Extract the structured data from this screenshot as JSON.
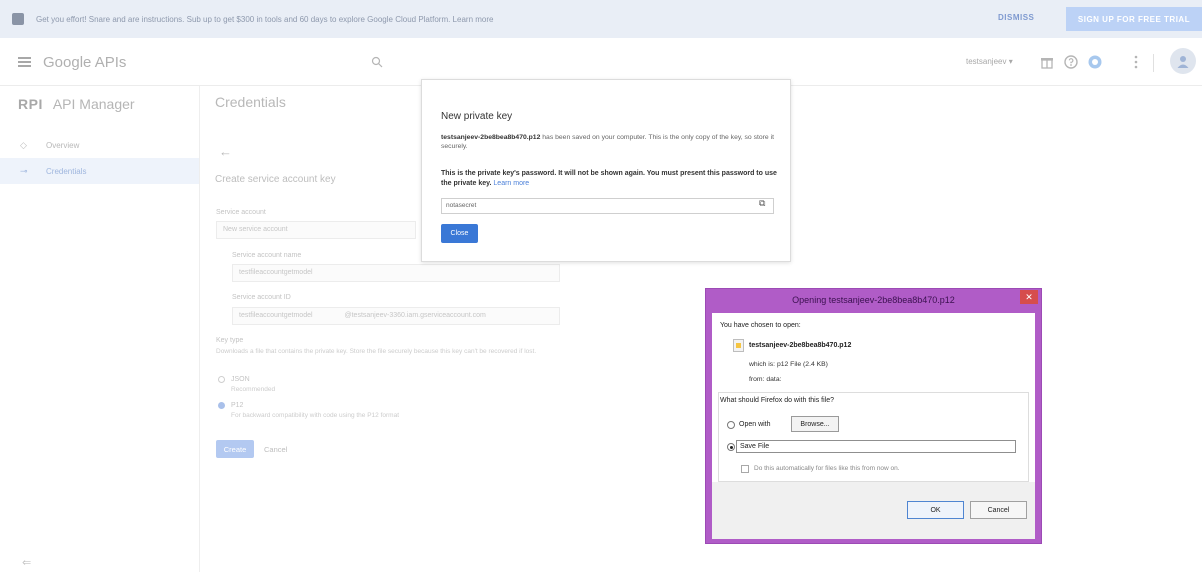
{
  "banner": {
    "text": "Get you effort! Snare and are instructions. Sub up to get $300 in tools and 60 days to explore Google Cloud Platform. Learn more",
    "dismiss_label": "DISMISS",
    "signup_label": "SIGN UP FOR FREE TRIAL"
  },
  "header": {
    "logo_text": "Google APIs",
    "project_label": "testsanjeev",
    "icons": [
      "menu-icon",
      "search-icon",
      "gift-icon",
      "help-icon",
      "notifications-icon",
      "more-icon",
      "account-icon"
    ]
  },
  "sidenav": {
    "badge": "RPI",
    "title": "API Manager",
    "items": [
      {
        "label": "Overview",
        "icon": "diamond-icon"
      },
      {
        "label": "Credentials",
        "icon": "key-icon"
      }
    ],
    "collapse_glyph": "⇐"
  },
  "main": {
    "page_title": "Credentials",
    "form_heading": "Create service account key",
    "service_account_label": "Service account",
    "service_account_value": "New service account",
    "name_label": "Service account name",
    "name_value": "testfileaccountgetmodel",
    "id_label": "Service account ID",
    "id_value": "testfileaccountgetmodel",
    "id_suffix": "@testsanjeev-3360.iam.gserviceaccount.com",
    "key_type_label": "Key type",
    "key_type_desc": "Downloads a file that contains the private key. Store the file securely because this key can't be recovered if lost.",
    "json_label": "JSON",
    "json_desc": "Recommended",
    "p12_label": "P12",
    "p12_desc": "For backward compatibility with code using the P12 format",
    "create_label": "Create",
    "cancel_label": "Cancel"
  },
  "private_key_dialog": {
    "title": "New private key",
    "filename": "testsanjeev-2be8bea8b470.p12",
    "saved_text": " has been saved on your computer. This is the only copy of the key, so store it securely.",
    "warning_text": "This is the private key's password. It will not be shown again. You must present this password to use the private key.",
    "learn_more": "Learn more",
    "password": "notasecret",
    "close_label": "Close"
  },
  "firefox_dialog": {
    "title": "Opening testsanjeev-2be8bea8b470.p12",
    "chosen_text": "You have chosen to open:",
    "filename": "testsanjeev-2be8bea8b470.p12",
    "which_is": "which is: p12 File (2.4 KB)",
    "from": "from: data:",
    "question": "What should Firefox do with this file?",
    "open_with": "Open with",
    "browse": "Browse...",
    "save_file": "Save File",
    "auto_text": "Do this automatically for files like this from now on.",
    "ok": "OK",
    "cancel": "Cancel",
    "selected_option": "Save File"
  },
  "colors": {
    "accent": "#3a78d6",
    "firefox_frame": "#b05cc7",
    "close_red": "#d64d4d"
  }
}
